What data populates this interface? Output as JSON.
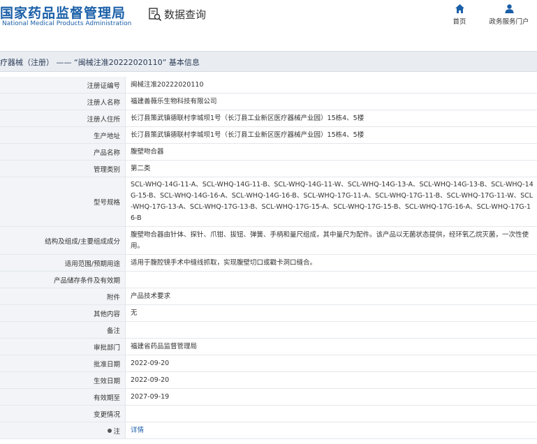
{
  "header": {
    "logo_cn": "国家药品监督管理局",
    "logo_en": "National Medical Products Administration",
    "query_title": "数据查询",
    "nav": [
      {
        "label": "首页",
        "icon": "home-icon"
      },
      {
        "label": "政务服务门户",
        "icon": "user-icon"
      }
    ]
  },
  "title_bar": "疗器械（注册） —— “闽械注准20222020110” 基本信息",
  "rows": [
    {
      "label": "注册证编号",
      "value": "闽械注准20222020110"
    },
    {
      "label": "注册人名称",
      "value": "福建善薇乐生物科技有限公司"
    },
    {
      "label": "注册人住所",
      "value": "长汀县策武镇德联村李城坝1号（长汀县工业新区医疗器械产业园）15栋4、5楼"
    },
    {
      "label": "生产地址",
      "value": "长汀县策武镇德联村李城坝1号（长汀县工业新区医疗器械产业园）15栋4、5楼"
    },
    {
      "label": "产品名称",
      "value": "腹壁吻合器"
    },
    {
      "label": "管理类别",
      "value": "第二类"
    },
    {
      "label": "型号规格",
      "value": "SCL-WHQ-14G-11-A、SCL-WHQ-14G-11-B、SCL-WHQ-14G-11-W、SCL-WHQ-14G-13-A、SCL-WHQ-14G-13-B、SCL-WHQ-14G-15-B、SCL-WHQ-14G-16-A、SCL-WHQ-14G-16-B、SCL-WHQ-17G-11-A、SCL-WHQ-17G-11-B、SCL-WHQ-17G-11-W、SCL-WHQ-17G-13-A、SCL-WHQ-17G-13-B、SCL-WHQ-17G-15-A、SCL-WHQ-17G-15-B、SCL-WHQ-17G-16-A、SCL-WHQ-17G-16-B"
    },
    {
      "label": "结构及组成/主要组成成分",
      "value": "腹壁吻合器由针体、探针、爪钳、拔钮、弹簧、手柄和量尺组成，其中量尺为配件。该产品以无菌状态提供，经环氧乙烷灭菌，一次性使用。"
    },
    {
      "label": "适用范围/预期用途",
      "value": "适用于腹腔镜手术中缝线抓取，实现腹壁切口或戳卡洞口缝合。"
    },
    {
      "label": "产品储存条件及有效期",
      "value": ""
    },
    {
      "label": "附件",
      "value": "产品技术要求"
    },
    {
      "label": "其他内容",
      "value": "无"
    },
    {
      "label": "备注",
      "value": ""
    },
    {
      "label": "审批部门",
      "value": "福建省药品监督管理局"
    },
    {
      "label": "批准日期",
      "value": "2022-09-20"
    },
    {
      "label": "生效日期",
      "value": "2022-09-20"
    },
    {
      "label": "有效期至",
      "value": "2027-09-19"
    },
    {
      "label": "变更情况",
      "value": ""
    },
    {
      "label": "注",
      "value": "详情"
    }
  ]
}
